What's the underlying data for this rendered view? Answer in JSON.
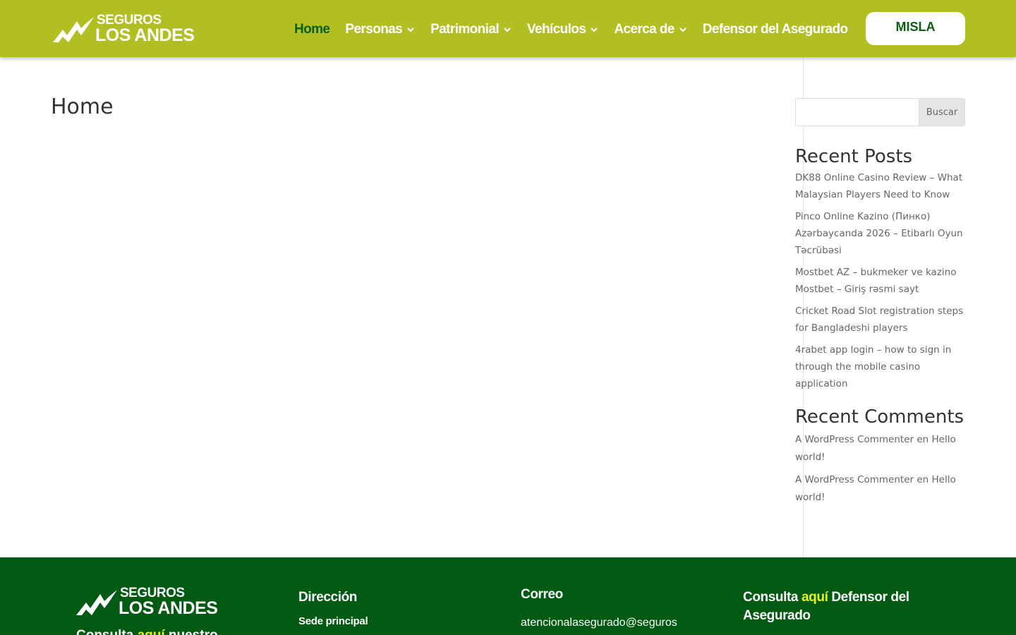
{
  "brand": {
    "logo_line1": "SEGUROS",
    "logo_line2": "LOS ANDES"
  },
  "colors": {
    "header_bg": "#b2bf22",
    "nav_active": "#0b5e12",
    "footer_bg": "#005a11",
    "highlight": "#e9f41c"
  },
  "nav": {
    "items": [
      {
        "label": "Home",
        "active": true,
        "has_dropdown": false
      },
      {
        "label": "Personas",
        "active": false,
        "has_dropdown": true
      },
      {
        "label": "Patrimonial",
        "active": false,
        "has_dropdown": true
      },
      {
        "label": "Vehículos",
        "active": false,
        "has_dropdown": true
      },
      {
        "label": "Acerca de",
        "active": false,
        "has_dropdown": true
      },
      {
        "label": "Defensor del Asegurado",
        "active": false,
        "has_dropdown": false
      }
    ],
    "cta_label": "MISLA"
  },
  "main": {
    "title": "Home"
  },
  "sidebar": {
    "search": {
      "placeholder": "",
      "value": "",
      "button_label": "Buscar"
    },
    "recent_posts": {
      "title": "Recent Posts",
      "items": [
        "DK88 Online Casino Review – What Malaysian Players Need to Know",
        "Pinco Online Kazino (Пинко) Azərbaycanda 2026 – Etibarlı Oyun Təcrübəsi",
        "Mostbet AZ – bukmeker ve kazino Mostbet – Giriş rəsmi sayt",
        "Cricket Road Slot registration steps for Bangladeshi players",
        "4rabet app login – how to sign in through the mobile casino application"
      ]
    },
    "recent_comments": {
      "title": "Recent Comments",
      "items": [
        {
          "author": "A WordPress Commenter",
          "connector": "en",
          "post": "Hello world!"
        },
        {
          "author": "A WordPress Commenter",
          "connector": "en",
          "post": "Hello world!"
        }
      ]
    }
  },
  "footer": {
    "logo_line1": "SEGUROS",
    "logo_line2": "LOS ANDES",
    "teaser_before": "Consulta",
    "teaser_highlight": "aquí",
    "teaser_after": "nuestro",
    "direccion": {
      "title": "Dirección",
      "subtitle": "Sede principal"
    },
    "correo": {
      "title": "Correo",
      "email": "atencionalasegurado@seguros"
    },
    "defensor": {
      "before": "Consulta",
      "highlight": "aquí",
      "after": "Defensor del Asegurado"
    }
  }
}
